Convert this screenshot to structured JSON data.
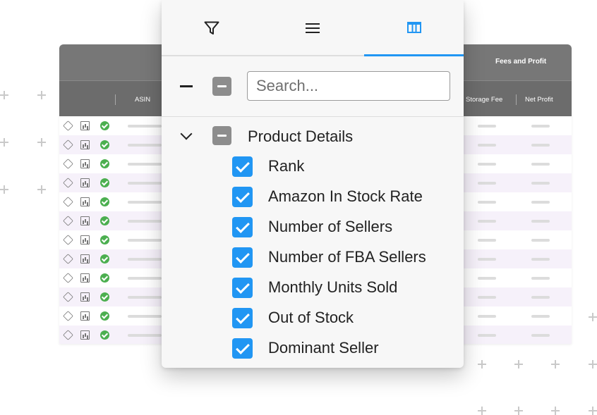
{
  "grid": {
    "header_group": "Fees and Profit",
    "columns": [
      "ASIN",
      "Storage Fee",
      "Net Profit"
    ],
    "row_count": 12
  },
  "panel": {
    "tabs": [
      {
        "icon": "filter-icon",
        "active": false
      },
      {
        "icon": "menu-icon",
        "active": false
      },
      {
        "icon": "columns-icon",
        "active": true
      }
    ],
    "search": {
      "placeholder": "Search...",
      "value": ""
    },
    "group": {
      "label": "Product Details",
      "items": [
        {
          "label": "Rank",
          "checked": true
        },
        {
          "label": "Amazon In Stock Rate",
          "checked": true
        },
        {
          "label": "Number of Sellers",
          "checked": true
        },
        {
          "label": "Number of FBA Sellers",
          "checked": true
        },
        {
          "label": "Monthly Units Sold",
          "checked": true
        },
        {
          "label": "Out of Stock",
          "checked": true
        },
        {
          "label": "Dominant Seller",
          "checked": true
        }
      ]
    }
  },
  "colors": {
    "accent": "#2196f3",
    "header": "#6c6c6c",
    "row_alt": "#f6f1fa",
    "status_ok": "#4caf50"
  }
}
